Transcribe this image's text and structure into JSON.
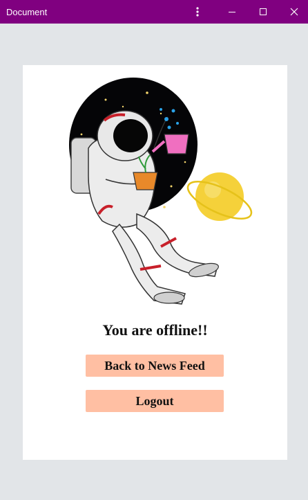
{
  "window": {
    "title": "Document",
    "controls": {
      "menu_icon": "more-vertical-icon",
      "minimize_icon": "minimize-icon",
      "maximize_icon": "maximize-icon",
      "close_icon": "close-icon"
    },
    "titlebar_color": "#800080"
  },
  "main": {
    "illustration": "astronaut-watering-plant-illustration",
    "message": "You are offline!!",
    "buttons": {
      "back_label": "Back to News Feed",
      "logout_label": "Logout"
    },
    "button_color": "#ffbfa3"
  }
}
